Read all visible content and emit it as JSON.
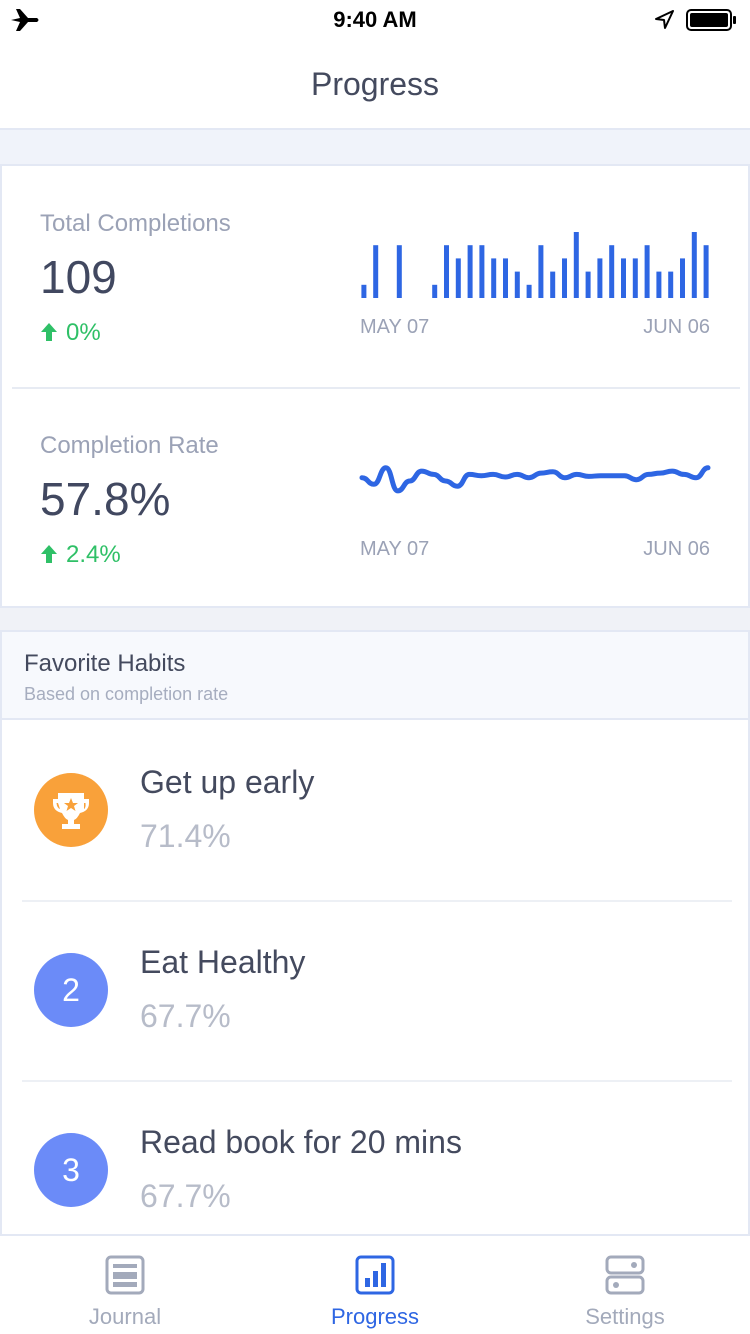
{
  "status_bar": {
    "time": "9:40 AM"
  },
  "nav": {
    "title": "Progress"
  },
  "stats": {
    "total": {
      "label": "Total Completions",
      "value": "109",
      "change": "0%",
      "date_start": "MAY 07",
      "date_end": "JUN 06"
    },
    "rate": {
      "label": "Completion Rate",
      "value": "57.8%",
      "change": "2.4%",
      "date_start": "MAY 07",
      "date_end": "JUN 06"
    }
  },
  "chart_data": [
    {
      "type": "bar",
      "series_values": [
        0.25,
        1,
        0,
        1,
        0,
        0,
        0.25,
        1,
        0.75,
        1,
        1,
        0.75,
        0.75,
        0.5,
        0.25,
        1,
        0.5,
        0.75,
        1.25,
        0.5,
        0.75,
        1,
        0.75,
        0.75,
        1,
        0.5,
        0.5,
        0.75,
        1.25,
        1
      ],
      "x_range_labels": [
        "MAY 07",
        "JUN 06"
      ]
    },
    {
      "type": "line",
      "series_values": [
        0.55,
        0.45,
        0.7,
        0.35,
        0.5,
        0.65,
        0.6,
        0.5,
        0.42,
        0.6,
        0.58,
        0.6,
        0.56,
        0.6,
        0.55,
        0.62,
        0.64,
        0.55,
        0.6,
        0.57,
        0.58,
        0.58,
        0.58,
        0.52,
        0.6,
        0.62,
        0.65,
        0.6,
        0.55,
        0.7
      ],
      "x_range_labels": [
        "MAY 07",
        "JUN 06"
      ]
    }
  ],
  "favorites": {
    "title": "Favorite Habits",
    "subtitle": "Based on completion rate",
    "items": [
      {
        "rank": "",
        "icon": "trophy-icon",
        "name": "Get up early",
        "rate": "71.4%"
      },
      {
        "rank": "2",
        "icon": "",
        "name": "Eat Healthy",
        "rate": "67.7%"
      },
      {
        "rank": "3",
        "icon": "",
        "name": "Read book for 20 mins",
        "rate": "67.7%"
      }
    ]
  },
  "tabs": [
    {
      "label": "Journal",
      "icon": "journal-icon",
      "active": false
    },
    {
      "label": "Progress",
      "icon": "bar-chart-icon",
      "active": true
    },
    {
      "label": "Settings",
      "icon": "settings-icon",
      "active": false
    }
  ],
  "colors": {
    "accent": "#2e66e3",
    "positive": "#2fc067",
    "gold": "#f9a13a",
    "rank_blue": "#6b8bf8"
  }
}
